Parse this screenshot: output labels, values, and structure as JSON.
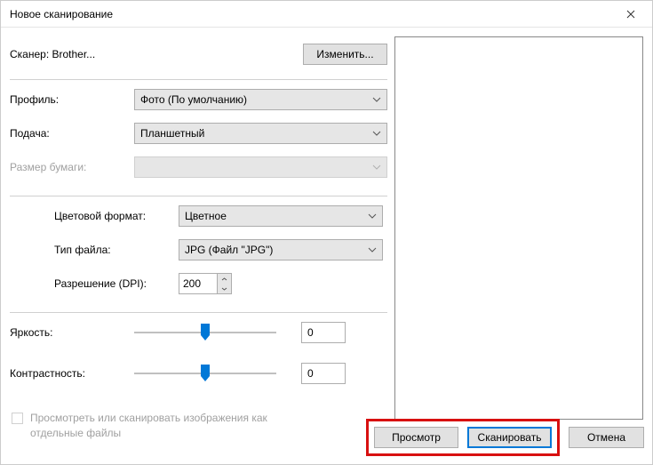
{
  "window": {
    "title": "Новое сканирование"
  },
  "scanner": {
    "label": "Сканер: Brother...",
    "change_btn": "Изменить..."
  },
  "form": {
    "profile_label": "Профиль:",
    "profile_value": "Фото (По умолчанию)",
    "source_label": "Подача:",
    "source_value": "Планшетный",
    "papersize_label": "Размер бумаги:",
    "papersize_value": "",
    "colorformat_label": "Цветовой формат:",
    "colorformat_value": "Цветное",
    "filetype_label": "Тип файла:",
    "filetype_value": "JPG (Файл \"JPG\")",
    "resolution_label": "Разрешение (DPI):",
    "resolution_value": "200",
    "brightness_label": "Яркость:",
    "brightness_value": "0",
    "contrast_label": "Контрастность:",
    "contrast_value": "0"
  },
  "checkbox": {
    "label": "Просмотреть или сканировать изображения как отдельные файлы"
  },
  "footer": {
    "preview_btn": "Просмотр",
    "scan_btn": "Сканировать",
    "cancel_btn": "Отмена"
  }
}
